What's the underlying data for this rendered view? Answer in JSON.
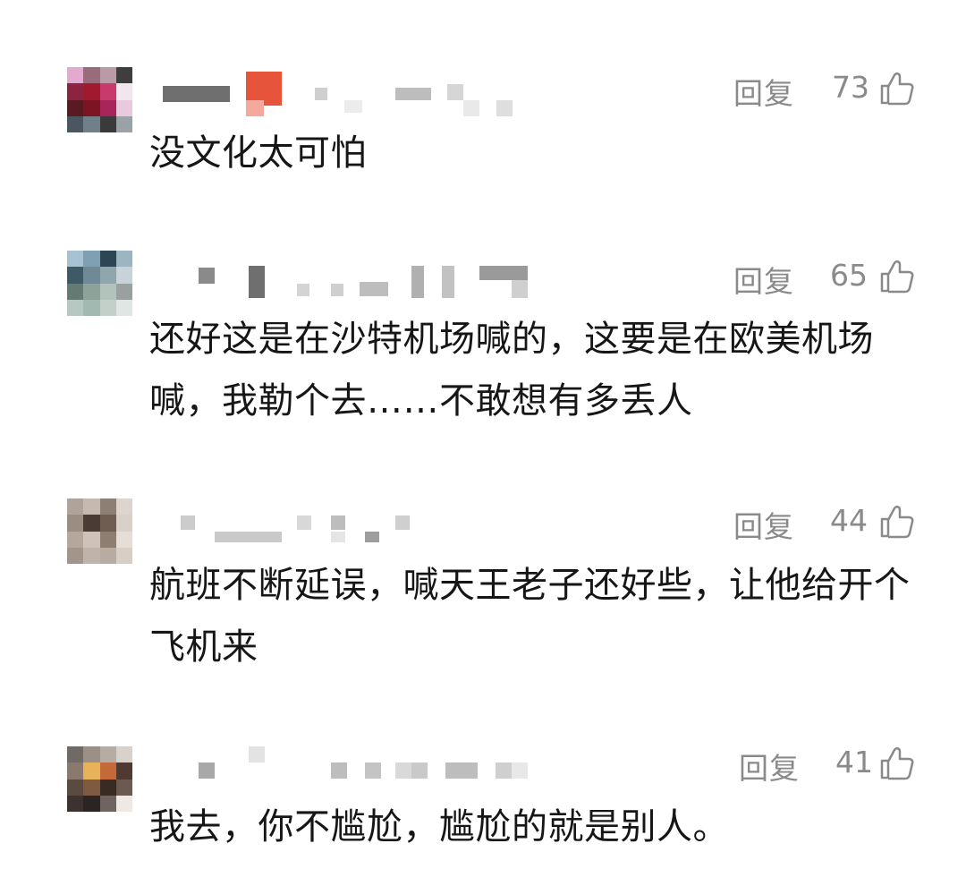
{
  "comments": [
    {
      "reply_label": "回复",
      "likes": "73",
      "text": "没文化太可怕",
      "avatar_colors": [
        "#e4a9cf",
        "#9a6b7b",
        "#b99aa7",
        "#3e3e3e",
        "#8c2441",
        "#a0192d",
        "#c93a6c",
        "#f1e6ee",
        "#5a1a22",
        "#7c1424",
        "#a7255a",
        "#e9c9dc",
        "#4a5660",
        "#6f8089",
        "#3a3a3a",
        "#9aa2a8"
      ],
      "username_mask": "redacted"
    },
    {
      "reply_label": "回复",
      "likes": "65",
      "text": "还好这是在沙特机场喊的，这要是在欧美机场喊，我勒个去……不敢想有多丢人",
      "avatar_colors": [
        "#a7c2d0",
        "#7ea0b2",
        "#2d4656",
        "#9bb6c1",
        "#3f5a67",
        "#6f8a96",
        "#8fa6ad",
        "#c7d3d8",
        "#647b74",
        "#8da399",
        "#b2c3bc",
        "#9a9fa0",
        "#b7c8c3",
        "#a1b9b0",
        "#c5cfc9",
        "#e0e6e3"
      ],
      "username_mask": "redacted"
    },
    {
      "reply_label": "回复",
      "likes": "44",
      "text": "航班不断延误，喊天王老子还好些，让他给开个飞机来",
      "avatar_colors": [
        "#b0a39a",
        "#c5b9b0",
        "#8d7f74",
        "#ddd4cd",
        "#9c8d82",
        "#4a3c34",
        "#6f5d52",
        "#d9d0c8",
        "#b5a79c",
        "#cfc2b8",
        "#8e7d71",
        "#e5ddd6",
        "#a3958a",
        "#c0b3a9",
        "#b8aba1",
        "#d7cec6"
      ],
      "username_mask": "redacted"
    },
    {
      "reply_label": "回复",
      "likes": "41",
      "text": "我去，你不尴尬，尴尬的就是别人。",
      "avatar_colors": [
        "#6f6a66",
        "#9c8f86",
        "#b5aca4",
        "#d9d2cc",
        "#8a7a6e",
        "#e8b25a",
        "#c46a3a",
        "#4e3a30",
        "#5a4a40",
        "#7d5a40",
        "#3a2a24",
        "#6a5a50",
        "#3c3230",
        "#2a2422",
        "#6e6460",
        "#efe9e5"
      ],
      "username_mask": "redacted"
    }
  ]
}
